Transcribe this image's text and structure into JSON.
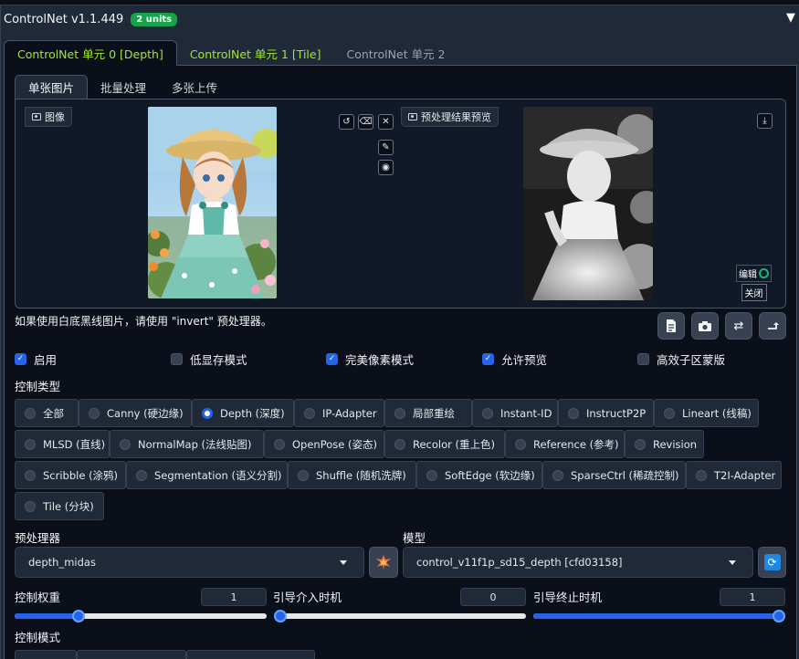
{
  "header": {
    "title": "ControlNet v1.1.449",
    "badge": "2 units",
    "collapse_icon": "▼"
  },
  "unit_tabs": [
    {
      "label": "ControlNet 单元 0 [Depth]"
    },
    {
      "label": "ControlNet 单元 1 [Tile]"
    },
    {
      "label": "ControlNet 单元 2"
    }
  ],
  "mode_tabs": [
    {
      "label": "单张图片"
    },
    {
      "label": "批量处理"
    },
    {
      "label": "多张上传"
    }
  ],
  "image_panel": {
    "input_label": "图像",
    "preview_label": "预处理结果预览",
    "edit_label": "编辑",
    "close_label": "关闭"
  },
  "hint": "如果使用白底黑线图片，请使用 \"invert\" 预处理器。",
  "checkboxes": [
    {
      "label": "启用",
      "checked": true
    },
    {
      "label": "低显存模式",
      "checked": false
    },
    {
      "label": "完美像素模式",
      "checked": true
    },
    {
      "label": "允许预览",
      "checked": true
    },
    {
      "label": "高效子区蒙版",
      "checked": false
    }
  ],
  "control_type": {
    "label": "控制类型",
    "options": [
      "全部",
      "Canny (硬边缘)",
      "Depth (深度)",
      "IP-Adapter",
      "局部重绘",
      "Instant-ID",
      "InstructP2P",
      "Lineart (线稿)",
      "MLSD (直线)",
      "NormalMap (法线贴图)",
      "OpenPose (姿态)",
      "Recolor (重上色)",
      "Reference (参考)",
      "Revision",
      "Scribble (涂鸦)",
      "Segmentation (语义分割)",
      "Shuffle (随机洗牌)",
      "SoftEdge (软边缘)",
      "SparseCtrl (稀疏控制)",
      "T2I-Adapter",
      "Tile (分块)"
    ],
    "selected": "Depth (深度)"
  },
  "preprocessor": {
    "label": "预处理器",
    "value": "depth_midas"
  },
  "model": {
    "label": "模型",
    "value": "control_v11f1p_sd15_depth [cfd03158]"
  },
  "sliders": {
    "weight": {
      "label": "控制权重",
      "value": "1",
      "fraction": 0.24
    },
    "start": {
      "label": "引导介入时机",
      "value": "0",
      "fraction": 0.0
    },
    "end": {
      "label": "引导终止时机",
      "value": "1",
      "fraction": 1.0
    }
  },
  "control_mode": {
    "label": "控制模式"
  },
  "colors": {
    "accent": "#2563eb",
    "badge": "#16a34a",
    "tab_active": "#a3e635",
    "background": "#0b0f19"
  }
}
